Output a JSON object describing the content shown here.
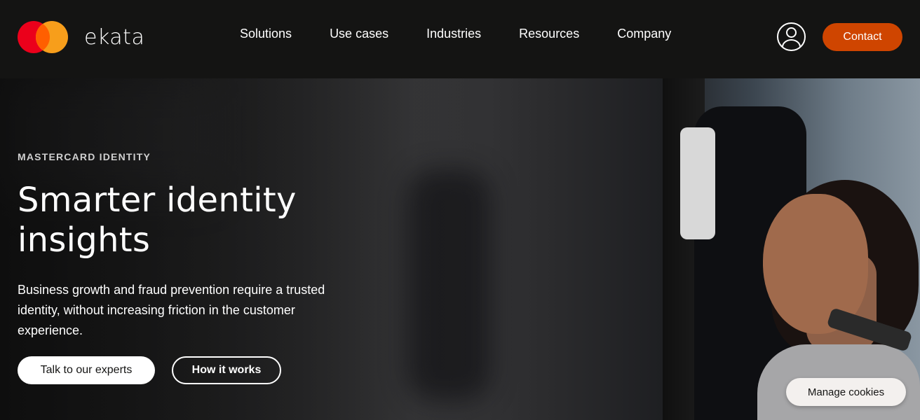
{
  "header": {
    "brand": "ekata",
    "logo_icon": "mastercard-circles-icon",
    "nav": [
      {
        "label": "Solutions"
      },
      {
        "label": "Use cases"
      },
      {
        "label": "Industries"
      },
      {
        "label": "Resources"
      },
      {
        "label": "Company"
      }
    ],
    "account_icon": "user-account-icon",
    "contact_label": "Contact"
  },
  "hero": {
    "eyebrow": "MASTERCARD IDENTITY",
    "headline": "Smarter identity insights",
    "subtext": "Business growth and fraud prevention require a trusted identity, without increasing friction in the customer experience.",
    "primary_cta": "Talk to our experts",
    "secondary_cta": "How it works"
  },
  "cookies": {
    "label": "Manage cookies"
  },
  "colors": {
    "header_bg": "#141413",
    "contact_bg": "#cf4500",
    "brand_red": "#eb001b",
    "brand_yellow": "#f79e1b"
  }
}
